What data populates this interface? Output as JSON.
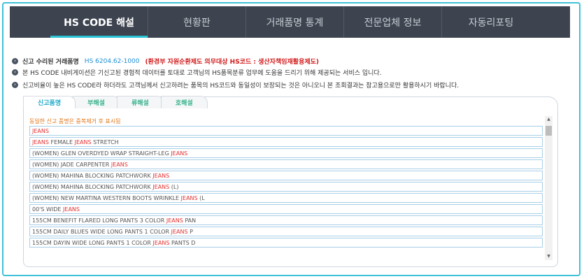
{
  "nav": {
    "items": [
      {
        "label": "HS CODE 해설",
        "active": true
      },
      {
        "label": "현황판",
        "active": false
      },
      {
        "label": "거래품명 통계",
        "active": false
      },
      {
        "label": "전문업체 정보",
        "active": false
      },
      {
        "label": "자동리포팅",
        "active": false
      }
    ]
  },
  "info": {
    "line1": {
      "label": "신고 수리된 거래품명",
      "hs": "HS 6204.62-1000",
      "warn": "(환경부 자원순환제도 의무대상 HS코드 : 생산자책임재활용제도)"
    },
    "line2": "본 HS CODE 내비게이션은 기신고된 경험적 데이터를 토대로 고객님의 HS품목분류 업무에 도움을 드리기 위해 제공되는 서비스 입니다.",
    "line3": "신고비율이 높은 HS CODE라 하더라도 고객님께서 신고하려는 품목의 HS코드와 동일성이 보장되는 것은 아니오니 본 조회결과는 참고용으로만 활용하시기 바랍니다."
  },
  "tabs": [
    {
      "label": "신고품명",
      "active": true
    },
    {
      "label": "부해설",
      "active": false
    },
    {
      "label": "류해설",
      "active": false
    },
    {
      "label": "호해설",
      "active": false
    }
  ],
  "notice": "동일한 신고 품명은 중복제거 후 표시됨",
  "items": [
    {
      "pre": "",
      "kw": "JEANS",
      "post": ""
    },
    {
      "pre": "",
      "kw": "JEANS",
      "post": " FEMALE ",
      "kw2": "JEANS",
      "post2": " STRETCH"
    },
    {
      "pre": "(WOMEN) GLEN OVERDYED WRAP STRAIGHT-LEG ",
      "kw": "JEANS",
      "post": ""
    },
    {
      "pre": "(WOMEN) JADE CARPENTER ",
      "kw": "JEANS",
      "post": ""
    },
    {
      "pre": "(WOMEN) MAHINA BLOCKING PATCHWORK ",
      "kw": "JEANS",
      "post": ""
    },
    {
      "pre": "(WOMEN) MAHINA BLOCKING PATCHWORK ",
      "kw": "JEANS",
      "post": " (L)"
    },
    {
      "pre": "(WOMEN) NEW MARTINA WESTERN BOOTS WRINKLE ",
      "kw": "JEANS",
      "post": " (L"
    },
    {
      "pre": "00'S WIDE ",
      "kw": "JEANS",
      "post": ""
    },
    {
      "pre": "155CM BENEFIT FLARED LONG PANTS 3 COLOR ",
      "kw": "JEANS",
      "post": " PAN"
    },
    {
      "pre": "155CM DAILY BLUES WIDE LONG PANTS 1 COLOR ",
      "kw": "JEANS",
      "post": " P"
    },
    {
      "pre": "155CM DAYIN WIDE LONG PANTS 1 COLOR ",
      "kw": "JEANS",
      "post": " PANTS D"
    }
  ]
}
